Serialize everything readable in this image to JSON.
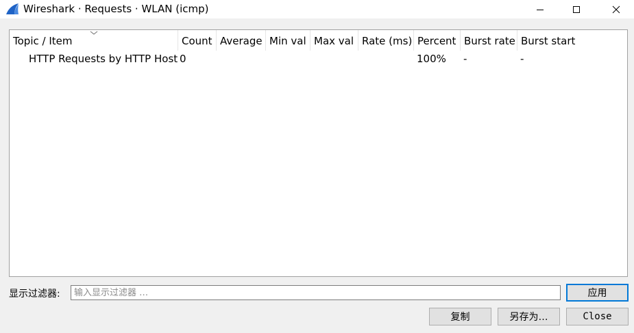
{
  "window": {
    "title": "Wireshark · Requests · WLAN (icmp)",
    "accent_color": "#1f63c6"
  },
  "table": {
    "columns": [
      {
        "key": "topic",
        "label": "Topic / Item"
      },
      {
        "key": "count",
        "label": "Count"
      },
      {
        "key": "average",
        "label": "Average"
      },
      {
        "key": "min",
        "label": "Min val"
      },
      {
        "key": "max",
        "label": "Max val"
      },
      {
        "key": "rate",
        "label": "Rate (ms)"
      },
      {
        "key": "percent",
        "label": "Percent"
      },
      {
        "key": "burst_rate",
        "label": "Burst rate"
      },
      {
        "key": "burst_start",
        "label": "Burst start"
      }
    ],
    "rows": [
      {
        "topic": "HTTP Requests by HTTP Host",
        "count": "0",
        "average": "",
        "min": "",
        "max": "",
        "rate": "",
        "percent": "100%",
        "burst_rate": "-",
        "burst_start": "-"
      }
    ]
  },
  "filter": {
    "label": "显示过滤器:",
    "placeholder": "输入显示过滤器 …",
    "value": ""
  },
  "buttons": {
    "apply": "应用",
    "copy": "复制",
    "save_as": "另存为…",
    "close": "Close"
  },
  "icons": {
    "app": "wireshark-fin-icon",
    "minimize": "minimize-icon",
    "maximize": "maximize-icon",
    "close": "close-icon",
    "sort": "sort-chevron-down-icon"
  }
}
